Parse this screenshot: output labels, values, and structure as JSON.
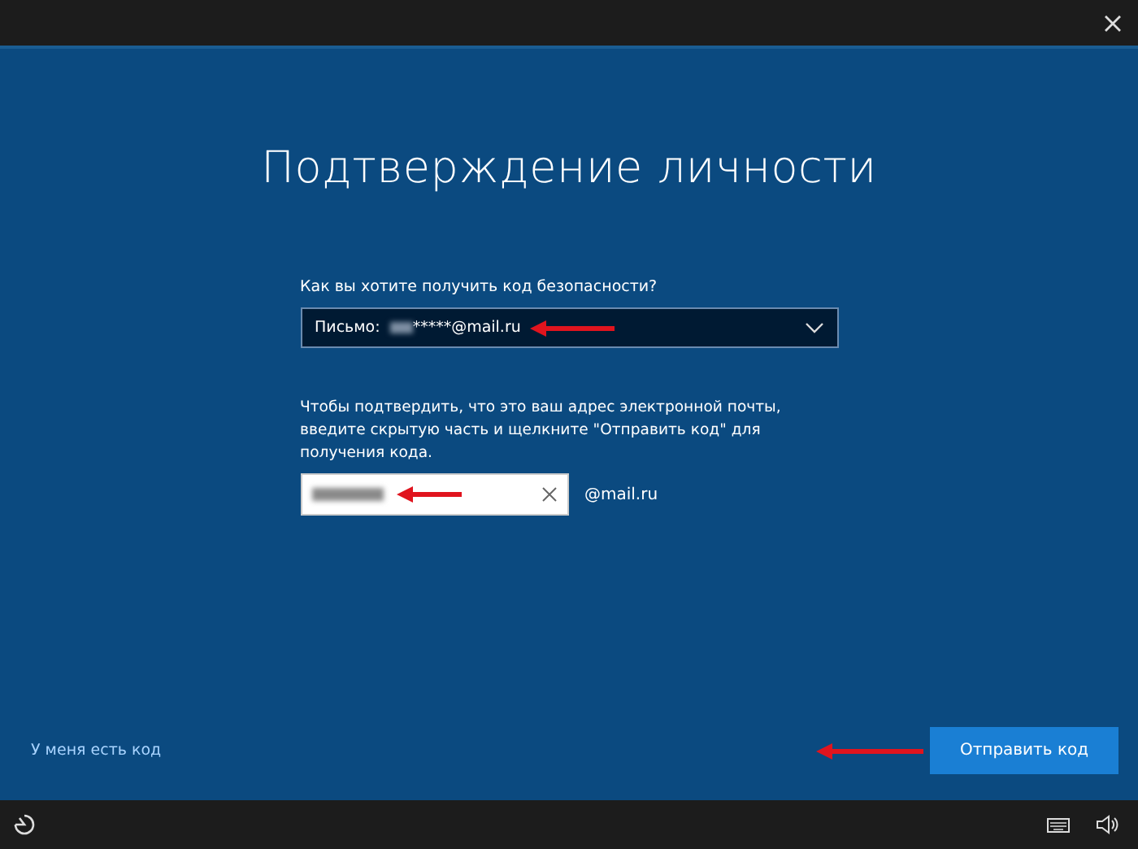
{
  "title": "Подтверждение личности",
  "method": {
    "label": "Как вы хотите получить код безопасности?",
    "prefix": "Письмо:",
    "value": "*****@mail.ru"
  },
  "verify": {
    "instruction": "Чтобы подтвердить, что это ваш адрес электронной почты, введите скрытую часть и щелкните \"Отправить код\" для получения кода.",
    "suffix": "@mail.ru"
  },
  "link": "У меня есть код",
  "buttons": [
    "Отправить код"
  ]
}
